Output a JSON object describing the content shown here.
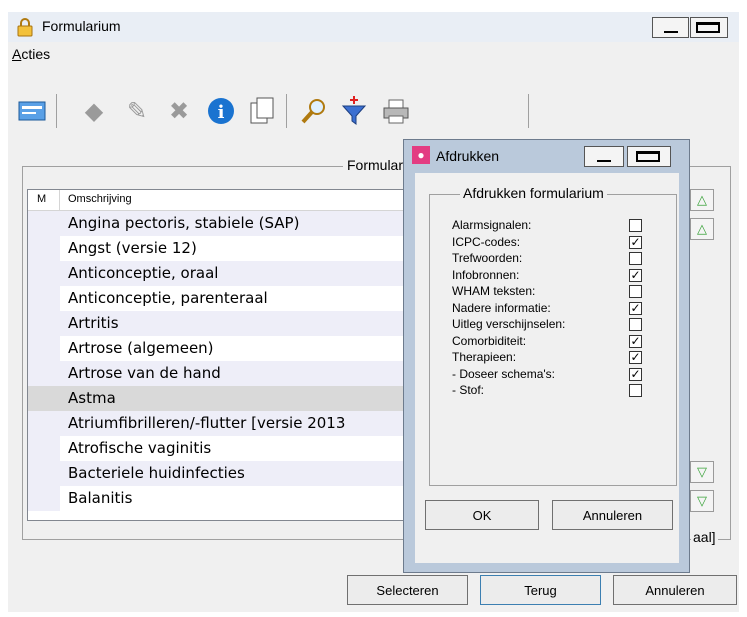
{
  "window": {
    "title": "Formularium",
    "icon": "lock-icon"
  },
  "menu": {
    "items": [
      "Acties"
    ]
  },
  "toolbar": {
    "icons": [
      "card-icon",
      "new-item-icon",
      "edit-pencil-icon",
      "delete-x-icon",
      "info-icon",
      "copy-pages-icon",
      "search-magnifier-icon",
      "filter-funnel-icon",
      "printer-icon"
    ]
  },
  "group": {
    "legend": "Formularium [Uitgebreid - Regionaal]",
    "legend_visible_left": "Formular",
    "legend_visible_right": "aal]"
  },
  "list": {
    "columns": [
      "M",
      "Omschrijving"
    ],
    "rows": [
      "Angina pectoris, stabiele (SAP)",
      "Angst (versie 12)",
      "Anticonceptie, oraal",
      "Anticonceptie, parenteraal",
      "Artritis",
      "Artrose (algemeen)",
      "Artrose van de hand",
      "Astma",
      "Atriumfibrilleren/-flutter [versie 2013",
      "Atrofische vaginitis",
      "Bacteriele huidinfecties",
      "Balanitis"
    ],
    "selected_index": 7
  },
  "buttons": {
    "select": "Selecteren",
    "back": "Terug",
    "cancel": "Annuleren"
  },
  "dialog": {
    "title": "Afdrukken",
    "legend": "Afdrukken formularium",
    "options": [
      {
        "label": "Alarmsignalen:",
        "checked": false
      },
      {
        "label": "ICPC-codes:",
        "checked": true
      },
      {
        "label": "Trefwoorden:",
        "checked": false
      },
      {
        "label": "Infobronnen:",
        "checked": true
      },
      {
        "label": "WHAM teksten:",
        "checked": false
      },
      {
        "label": "Nadere informatie:",
        "checked": true
      },
      {
        "label": "Uitleg verschijnselen:",
        "checked": false
      },
      {
        "label": "Comorbiditeit:",
        "checked": true
      },
      {
        "label": "Therapieen:",
        "checked": true
      },
      {
        "label": "- Doseer schema's:",
        "checked": true
      },
      {
        "label": "- Stof:",
        "checked": false
      }
    ],
    "ok": "OK",
    "cancel": "Annuleren"
  },
  "colors": {
    "titlebar": "#e9eef5",
    "dialog_frame": "#bac9db",
    "list_alt": "#eeeef8",
    "selected_row": "#d9d9d9",
    "arrow": "#3aa33a"
  }
}
